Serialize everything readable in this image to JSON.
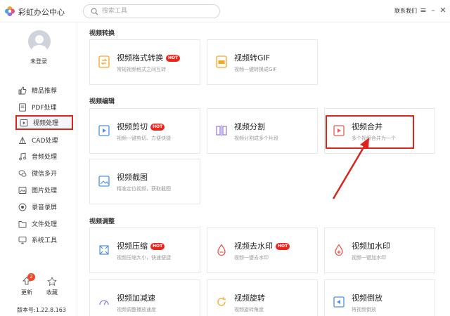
{
  "app": {
    "title": "彩虹办公中心",
    "contact": "联系我们",
    "window_buttons": [
      "≡",
      "–",
      "✕"
    ]
  },
  "search": {
    "placeholder": "搜索工具"
  },
  "sidebar": {
    "login": "未登录",
    "items": [
      {
        "label": "精品推荐",
        "icon": "thumbs-up-icon",
        "active": false
      },
      {
        "label": "PDF处理",
        "icon": "pdf-icon",
        "active": false
      },
      {
        "label": "视频处理",
        "icon": "video-icon",
        "active": true
      },
      {
        "label": "CAD处理",
        "icon": "cad-icon",
        "active": false
      },
      {
        "label": "音频处理",
        "icon": "music-icon",
        "active": false
      },
      {
        "label": "微信多开",
        "icon": "wechat-icon",
        "active": false
      },
      {
        "label": "图片处理",
        "icon": "image-icon",
        "active": false
      },
      {
        "label": "录音录屏",
        "icon": "record-icon",
        "active": false
      },
      {
        "label": "文件处理",
        "icon": "folder-icon",
        "active": false
      },
      {
        "label": "系统工具",
        "icon": "system-icon",
        "active": false
      }
    ],
    "update_label": "更新",
    "update_badge": "2",
    "favorite_label": "收藏",
    "version": "版本号:1.22.8.163"
  },
  "sections": [
    {
      "title": "视频转换",
      "cards": [
        {
          "title": "视频格式转换",
          "desc": "常规视频格式之间互转",
          "hot": true,
          "icon": "video-convert-icon"
        },
        {
          "title": "视频转GIF",
          "desc": "视频一键转换成GIF",
          "hot": false,
          "icon": "gif-icon"
        }
      ]
    },
    {
      "title": "视频编辑",
      "cards": [
        {
          "title": "视频剪切",
          "desc": "视频一键剪切、方便快捷",
          "hot": true,
          "icon": "video-cut-icon"
        },
        {
          "title": "视频分割",
          "desc": "视频分割成多个片段",
          "hot": false,
          "icon": "video-split-icon"
        },
        {
          "title": "视频合并",
          "desc": "多个视频合并为一个",
          "hot": false,
          "icon": "video-merge-icon"
        },
        {
          "title": "视频截图",
          "desc": "精准定位视频，获取截图",
          "hot": false,
          "icon": "video-screenshot-icon"
        }
      ]
    },
    {
      "title": "视频调整",
      "cards": [
        {
          "title": "视频压缩",
          "desc": "视频压缩大小，快速便捷",
          "hot": true,
          "icon": "video-compress-icon"
        },
        {
          "title": "视频去水印",
          "desc": "视频一键去水印",
          "hot": true,
          "icon": "remove-watermark-icon"
        },
        {
          "title": "视频加水印",
          "desc": "视频一键加水印",
          "hot": false,
          "icon": "add-watermark-icon"
        },
        {
          "title": "视频加减速",
          "desc": "视频调整播放速度",
          "hot": false,
          "icon": "video-speed-icon"
        },
        {
          "title": "视频旋转",
          "desc": "视频旋转角度",
          "hot": false,
          "icon": "video-rotate-icon"
        },
        {
          "title": "视频倒放",
          "desc": "将视频倒放",
          "hot": false,
          "icon": "video-reverse-icon"
        }
      ]
    }
  ],
  "hot_label": "HOT",
  "colors": {
    "accent_red": "#d9251c",
    "hot_badge": "#e8261e",
    "icon_orange": "#f5a623",
    "icon_blue": "#4a90e2",
    "icon_red": "#e85a4f",
    "icon_purple": "#9b7fe0",
    "icon_green": "#3fb57a"
  }
}
